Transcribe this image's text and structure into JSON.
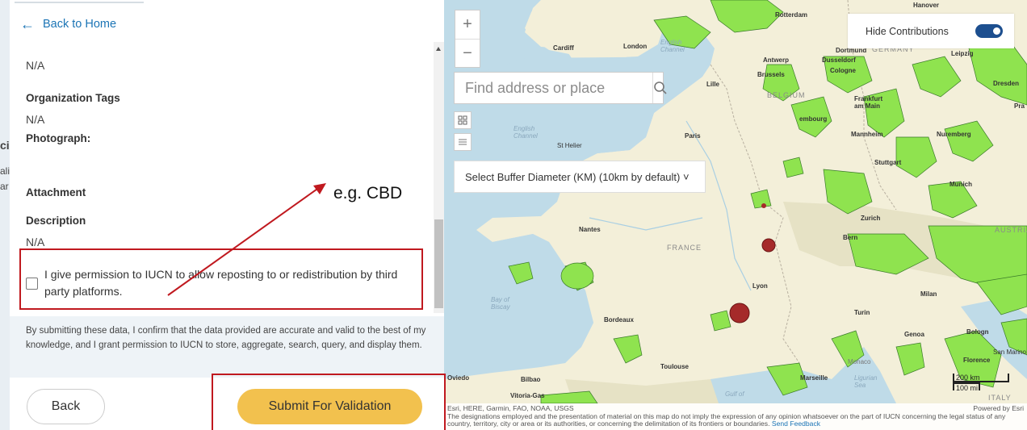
{
  "left_panel": {
    "back_link": "Back to Home",
    "truncated_left": [
      "ci",
      "ali",
      "ar"
    ],
    "fields": [
      {
        "label": "",
        "value": "N/A"
      },
      {
        "label": "Organization Tags",
        "value": "N/A"
      },
      {
        "label": "Photograph:",
        "value": ""
      },
      {
        "label": "Attachment",
        "value": ""
      },
      {
        "label": "Description",
        "value": "N/A"
      }
    ],
    "permission_checkbox": {
      "checked": false,
      "label": "I give permission to IUCN to allow reposting to or redistribution by third party platforms."
    },
    "disclaimer": "By submitting these data, I confirm that the data provided are accurate and valid to the best of my knowledge, and I grant permission to IUCN to store, aggregate, search, query, and display them.",
    "back_button": "Back",
    "submit_button": "Submit For Validation"
  },
  "annotation": {
    "text": "e.g. CBD",
    "color": "#c0191f"
  },
  "map": {
    "search_placeholder": "Find address or place",
    "zoom_in": "+",
    "zoom_out": "−",
    "buffer_select": "Select Buffer Diameter (KM) (10km by default) ˅",
    "hide_contributions_label": "Hide Contributions",
    "hide_contributions_on": true,
    "scale_large": "200 km",
    "scale_small": "100 mi",
    "attribution_sources": "Esri, HERE, Garmin, FAO, NOAA, USGS",
    "powered_by": "Powered by Esri",
    "disclaimer": "The designations employed and the presentation of material on this map do not imply the expression of any opinion whatsoever on the part of IUCN concerning the legal status of any country, territory, city or area or its authorities, or concerning the delimitation of its frontiers or boundaries.",
    "send_feedback": "Send Feedback",
    "place_labels": {
      "hanover": "Hanover",
      "rotterdam": "Rotterdam",
      "dortmund": "Dortmund",
      "germany": "GERMANY",
      "leipzig": "Leipzig",
      "dresden": "Dresden",
      "cardiff": "Cardiff",
      "london": "London",
      "english_channel_north": "English Channel",
      "antwerp": "Antwerp",
      "dusseldorf": "Dusseldorf",
      "cologne": "Cologne",
      "brussels": "Brussels",
      "lille": "Lille",
      "belgium": "BELGIUM",
      "frankfurt": "Frankfurt am Main",
      "prague": "Pra",
      "luxembourg": "embourg",
      "mannheim": "Mannheim",
      "nuremberg": "Nuremberg",
      "english_channel_south": "English Channel",
      "st_helier": "St Helier",
      "paris": "Paris",
      "stuttgart": "Stuttgart",
      "munich": "Munich",
      "zurich": "Zurich",
      "bern": "Bern",
      "austria": "AUSTRIA",
      "nantes": "Nantes",
      "france": "FRANCE",
      "lyon": "Lyon",
      "milan": "Milan",
      "bay_of_biscay": "Bay of Biscay",
      "bordeaux": "Bordeaux",
      "turin": "Turin",
      "genoa": "Genoa",
      "bologna": "Bologn",
      "san_marino": "San Marino",
      "florence": "Florence",
      "toulouse": "Toulouse",
      "marseille": "Marseille",
      "monaco": "Monaco",
      "ligurian_sea": "Ligurian Sea",
      "oviedo": "Oviedo",
      "bilbao": "Bilbao",
      "vitoria": "Vitoria-Gas",
      "gulf_of_lion": "Gulf of",
      "italy": "ITALY"
    }
  },
  "colors": {
    "link_blue": "#1b74b5",
    "submit_yellow": "#f2c14e",
    "protected_green": "#8fe34f",
    "marker_red": "#a52a2a",
    "toggle_navy": "#1d4f8f"
  }
}
